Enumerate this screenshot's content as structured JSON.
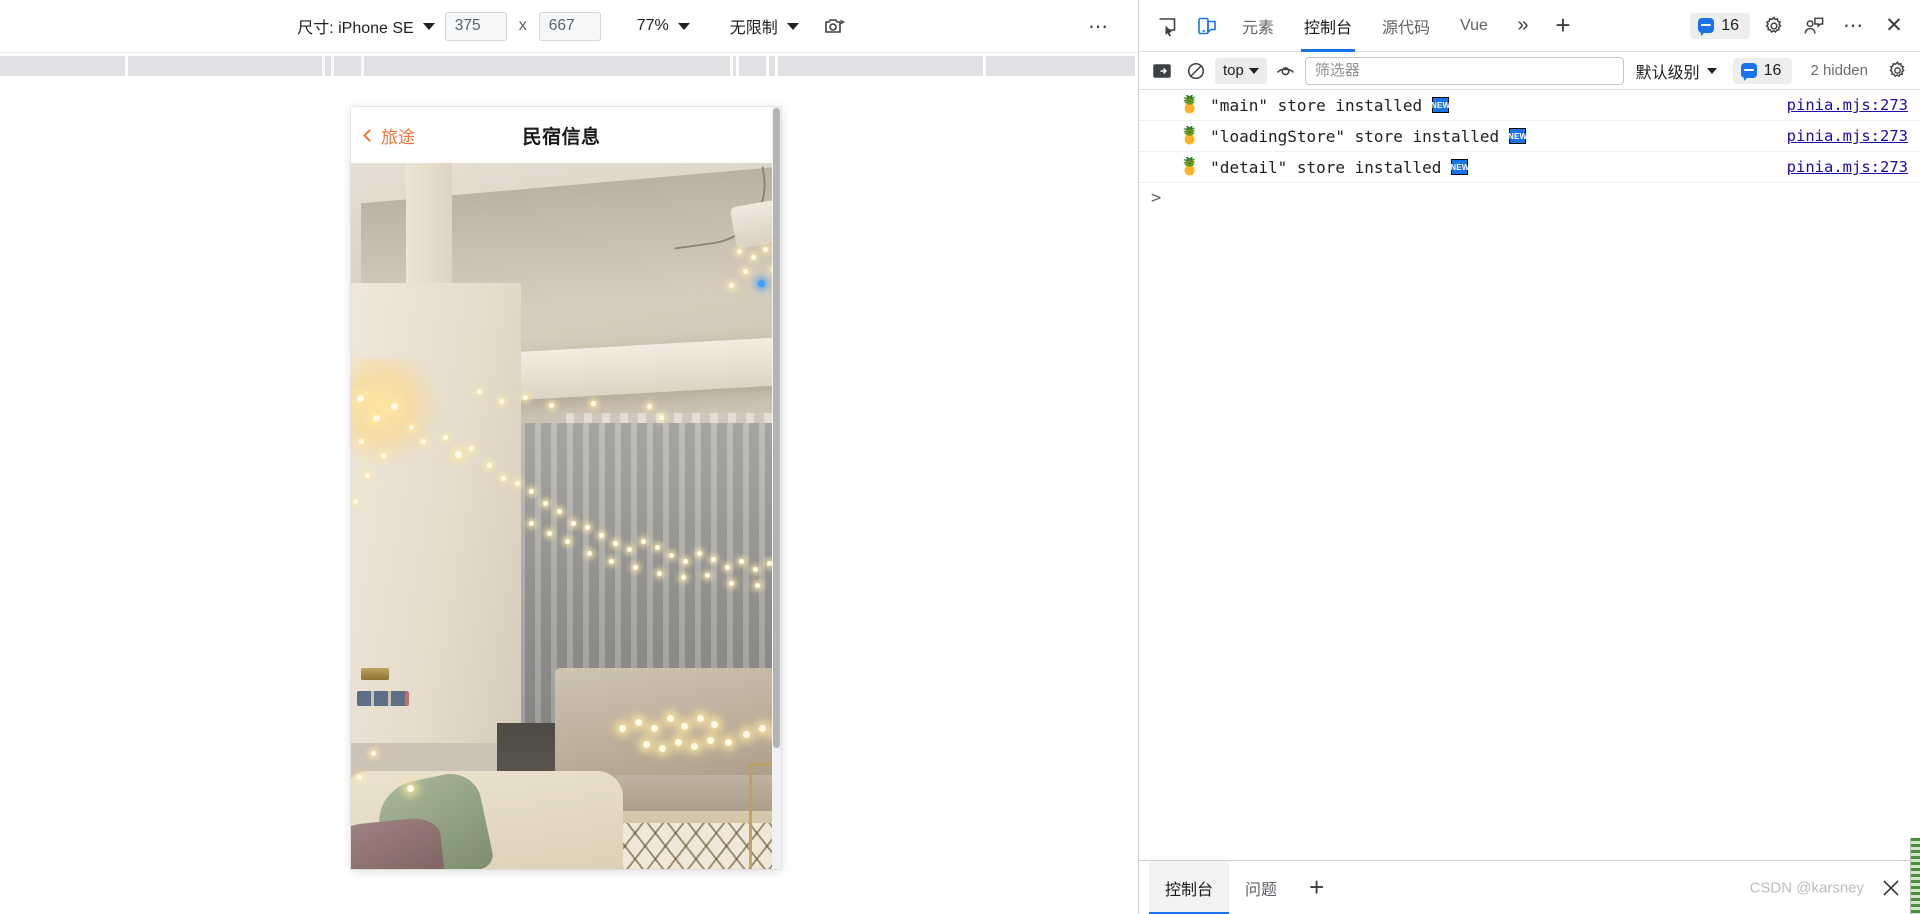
{
  "device_toolbar": {
    "size_label": "尺寸: iPhone SE",
    "width_value": "375",
    "dim_separator": "x",
    "height_value": "667",
    "zoom_value": "77%",
    "throttling_value": "无限制",
    "screenshot_icon": "capture-screenshot-icon",
    "more_options_icon": "more-options-icon",
    "more_options_label": "⋯"
  },
  "phone": {
    "header": {
      "back_label": "旅途",
      "title": "民宿信息"
    },
    "photo_alt": "民宿房间照片"
  },
  "devtools": {
    "toolbar": {
      "inspect_icon": "inspect-element-icon",
      "device_toggle_icon": "toggle-device-toolbar-icon",
      "tabs": [
        {
          "label": "元素",
          "active": false
        },
        {
          "label": "控制台",
          "active": true
        },
        {
          "label": "源代码",
          "active": false
        },
        {
          "label": "Vue",
          "active": false
        }
      ],
      "more_tabs_label": "»",
      "add_tab_label": "+",
      "issues_count": "16",
      "settings_icon": "gear-icon",
      "feedback_icon": "feedback-icon",
      "more_icon": "more-options-icon",
      "more_label": "⋯",
      "close_label": "✕"
    },
    "console_toolbar": {
      "sidebar_icon": "console-sidebar-icon",
      "clear_icon": "clear-console-icon",
      "context_value": "top",
      "eye_icon": "live-expression-icon",
      "filter_placeholder": "筛选器",
      "filter_value": "",
      "level_label": "默认级别",
      "issues_count": "16",
      "hidden_label": "2 hidden",
      "settings_icon": "console-settings-icon"
    },
    "logs": [
      {
        "icon": "🍍",
        "text": "\"main\" store installed",
        "badge": "NEW",
        "source": "pinia.mjs:273"
      },
      {
        "icon": "🍍",
        "text": "\"loadingStore\" store installed",
        "badge": "NEW",
        "source": "pinia.mjs:273"
      },
      {
        "icon": "🍍",
        "text": "\"detail\" store installed",
        "badge": "NEW",
        "source": "pinia.mjs:273"
      }
    ],
    "prompt": ">",
    "drawer": {
      "tabs": [
        {
          "label": "控制台",
          "active": true
        },
        {
          "label": "问题",
          "active": false
        }
      ],
      "add_label": "+",
      "close_label": "✕"
    }
  },
  "watermark": "CSDN @karsney",
  "colors": {
    "accent": "#1a73e8",
    "link": "#1a0dab",
    "brand_orange": "#f2743a"
  }
}
